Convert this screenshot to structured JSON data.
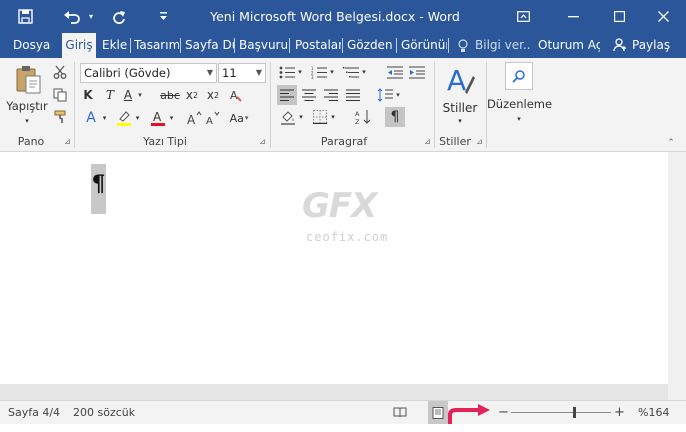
{
  "titlebar": {
    "title": "Yeni Microsoft Word Belgesi.docx - Word",
    "save_icon": "save-icon",
    "undo_icon": "undo-icon",
    "redo_icon": "redo-icon",
    "minimize_icon": "minimize-icon",
    "maximize_icon": "maximize-icon",
    "close_icon": "close-icon",
    "ribbon_display_icon": "ribbon-display-options-icon",
    "bg_color": "#2b579a"
  },
  "tabs": {
    "file": "Dosya",
    "home": "Giriş",
    "insert": "Ekle",
    "design": "Tasarım",
    "layout": "Sayfa Dü",
    "references": "Başvurul",
    "mailings": "Postalar",
    "review": "Gözden (",
    "view": "Görünür",
    "tell_me": "Bilgi ver...",
    "sign_in": "Oturum Aç",
    "share": "Paylaş"
  },
  "ribbon": {
    "clipboard": {
      "label": "Pano",
      "paste": "Yapıştır"
    },
    "font": {
      "label": "Yazı Tipi",
      "font_name": "Calibri (Gövde)",
      "font_size": "11",
      "bold": "K",
      "italic": "T",
      "underline": "A",
      "strike": "abc",
      "subscript": "x",
      "subscript_mark": "2",
      "superscript": "x",
      "superscript_mark": "2",
      "text_effects": "A",
      "font_color": "A",
      "grow": "A",
      "shrink": "A",
      "change_case": "Aa",
      "font_color_accent": "#e81123",
      "highlight_accent": "#ffff00"
    },
    "paragraph": {
      "label": "Paragraf",
      "show_marks": "¶"
    },
    "styles": {
      "label": "Stiller",
      "button": "Stiller"
    },
    "editing": {
      "button": "Düzenleme"
    }
  },
  "document": {
    "pilcrow": "¶",
    "watermark_logo": "GFX",
    "watermark_site": "ceofix.com"
  },
  "statusbar": {
    "page": "Sayfa 4/4",
    "words": "200 sözcük",
    "zoom_minus": "−",
    "zoom_plus": "+",
    "zoom_level": "%164",
    "zoom_fraction": 0.63,
    "arrow_color": "#e5215a"
  }
}
